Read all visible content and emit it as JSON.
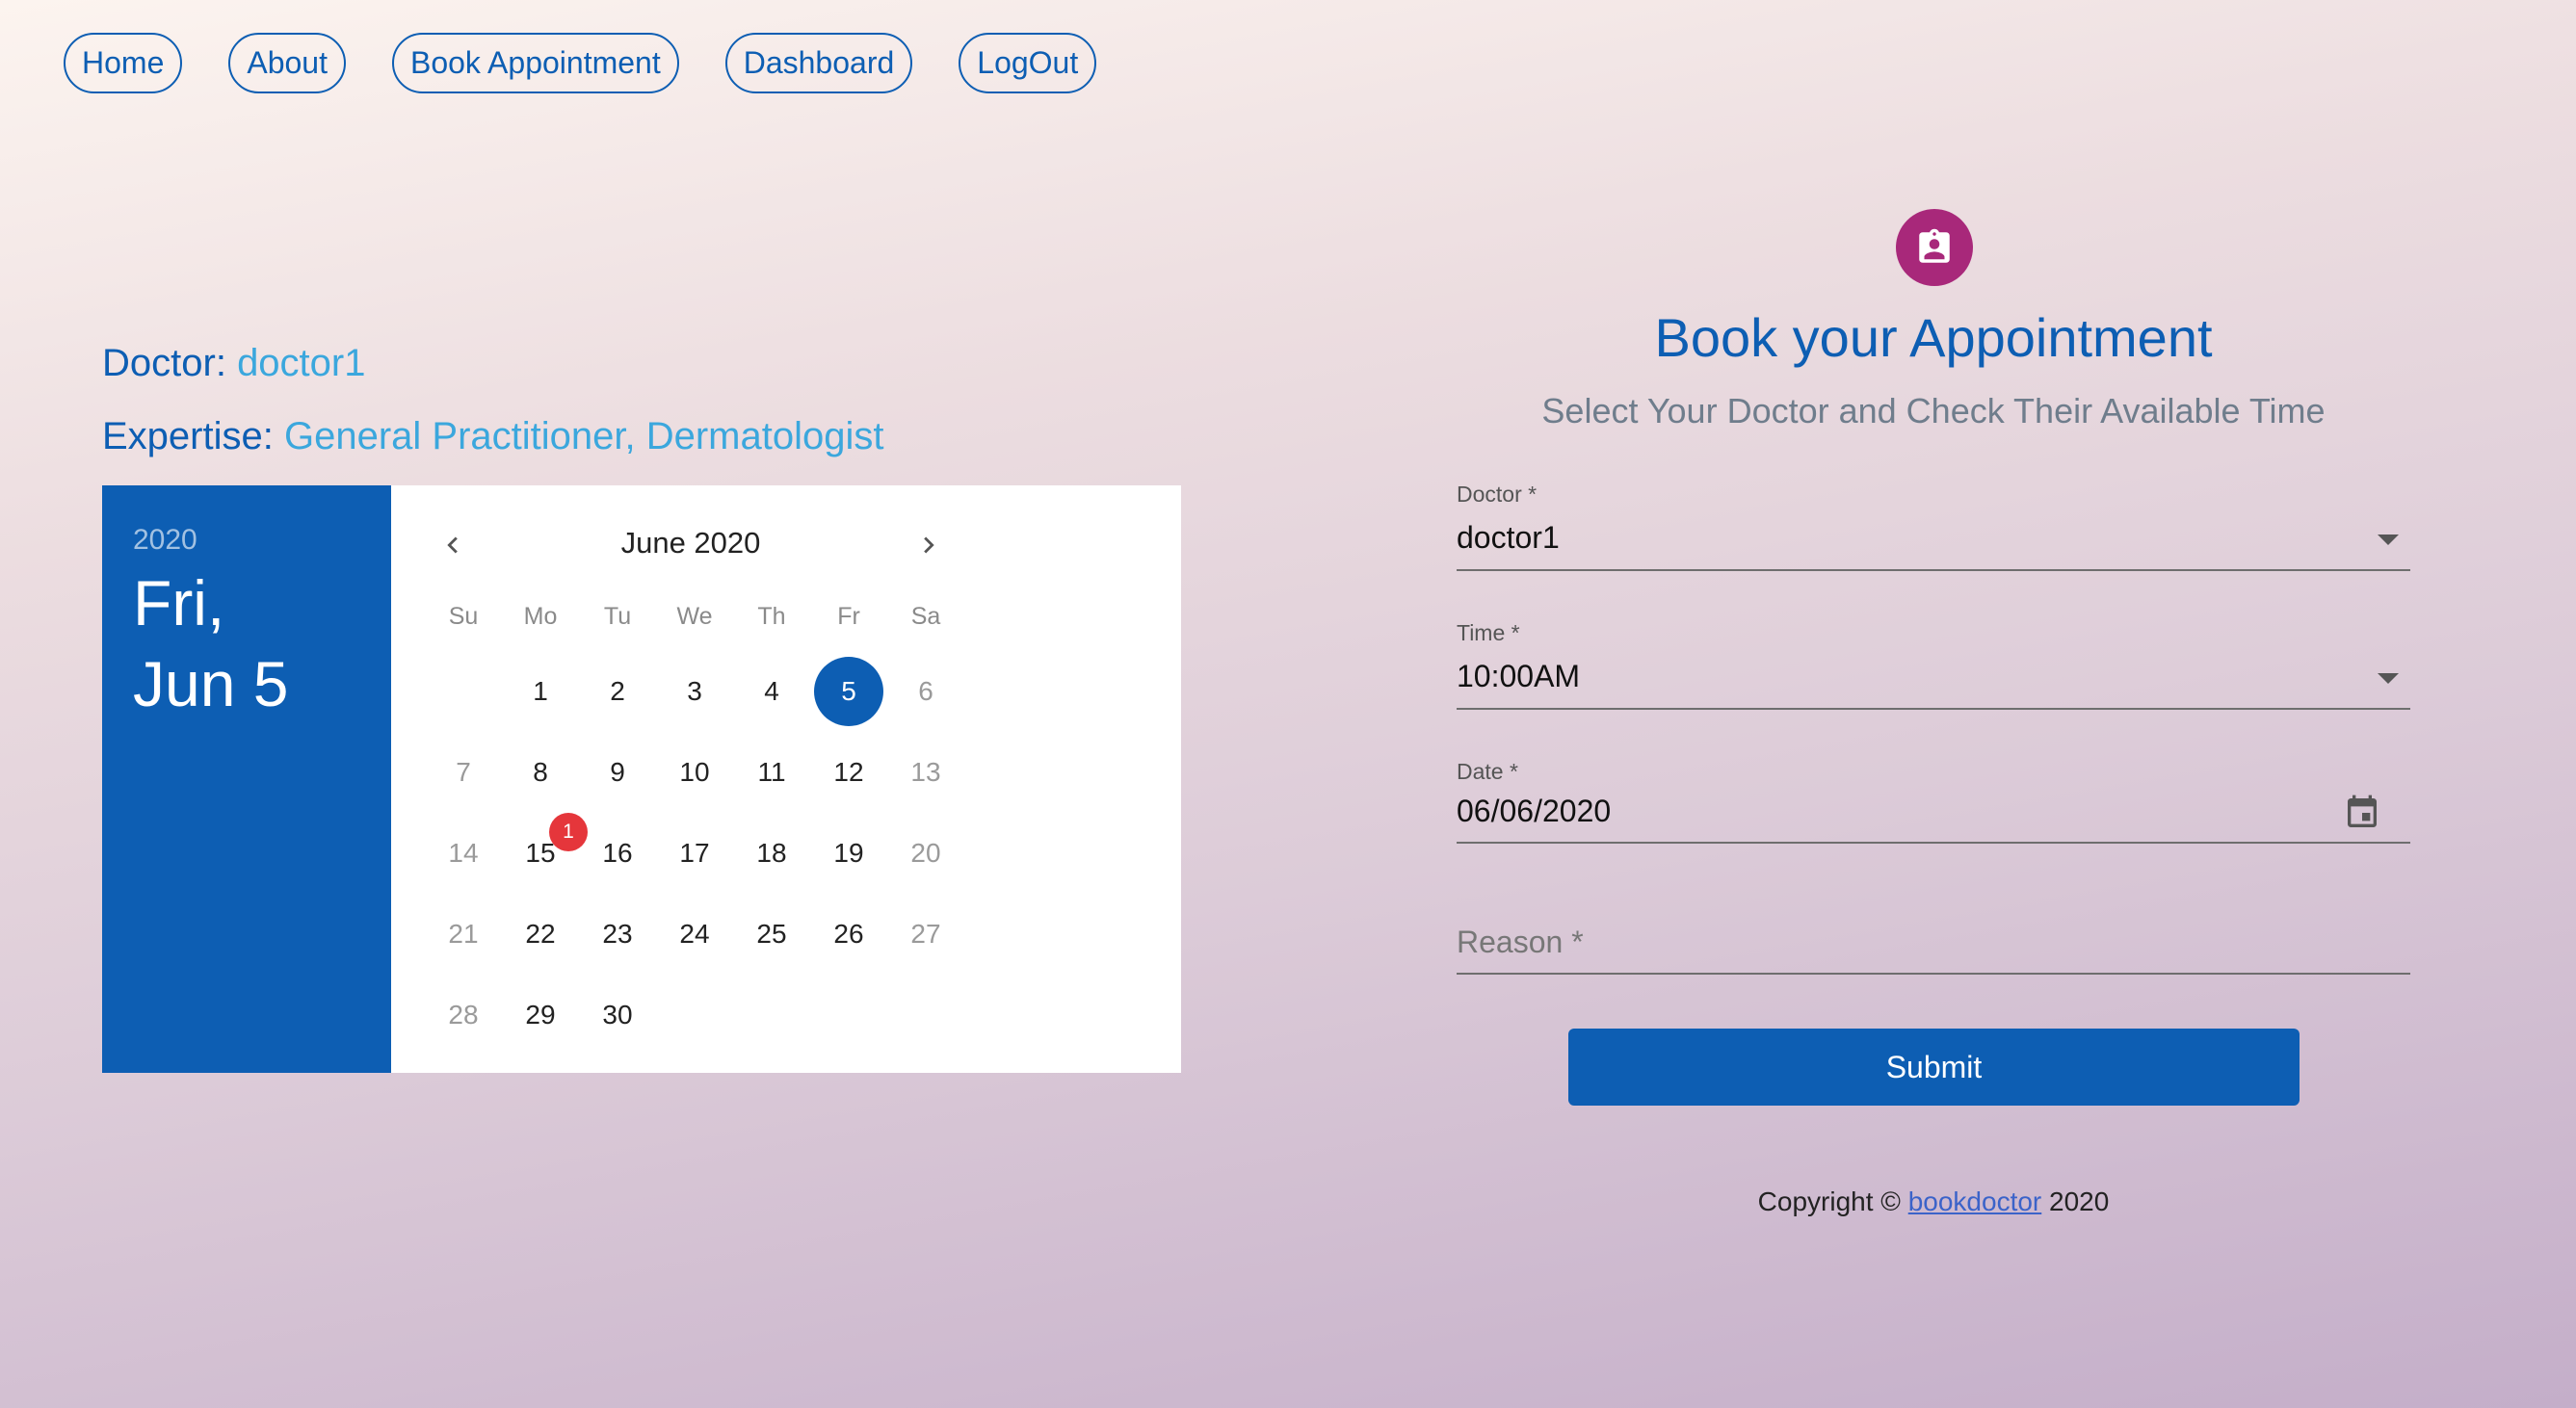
{
  "nav": {
    "items": [
      "Home",
      "About",
      "Book Appointment",
      "Dashboard",
      "LogOut"
    ]
  },
  "doctor_info": {
    "doctor_label": "Doctor:",
    "doctor_value": "doctor1",
    "expertise_label": "Expertise:",
    "expertise_value": "General Practitioner, Dermatologist"
  },
  "calendar": {
    "year": "2020",
    "selected_weekday": "Fri,",
    "selected_date": "Jun 5",
    "month_label": "June 2020",
    "prev_icon": "chevron-left-icon",
    "next_icon": "chevron-right-icon",
    "days_of_week": [
      "Su",
      "Mo",
      "Tu",
      "We",
      "Th",
      "Fr",
      "Sa"
    ],
    "weeks": [
      [
        "",
        "1",
        "2",
        "3",
        "4",
        "5",
        "6"
      ],
      [
        "7",
        "8",
        "9",
        "10",
        "11",
        "12",
        "13"
      ],
      [
        "14",
        "15",
        "16",
        "17",
        "18",
        "19",
        "20"
      ],
      [
        "21",
        "22",
        "23",
        "24",
        "25",
        "26",
        "27"
      ],
      [
        "28",
        "29",
        "30",
        "",
        "",
        "",
        ""
      ]
    ],
    "selected_day": "5",
    "badge_day": "15",
    "badge_count": "1",
    "colors": {
      "accent": "#0d5eb3",
      "badge": "#e5363b"
    }
  },
  "form": {
    "icon": "contact-badge-icon",
    "title": "Book your Appointment",
    "subtitle": "Select Your Doctor and Check Their Available Time",
    "doctor_label": "Doctor *",
    "doctor_value": "doctor1",
    "time_label": "Time *",
    "time_value": "10:00AM",
    "date_label": "Date *",
    "date_value": "06/06/2020",
    "date_icon": "calendar-icon",
    "reason_label": "Reason *",
    "submit_label": "Submit",
    "icon_color": "#a8287a"
  },
  "footer": {
    "copyright_prefix": "Copyright ©",
    "link_text": "bookdoctor",
    "year": "2020"
  }
}
